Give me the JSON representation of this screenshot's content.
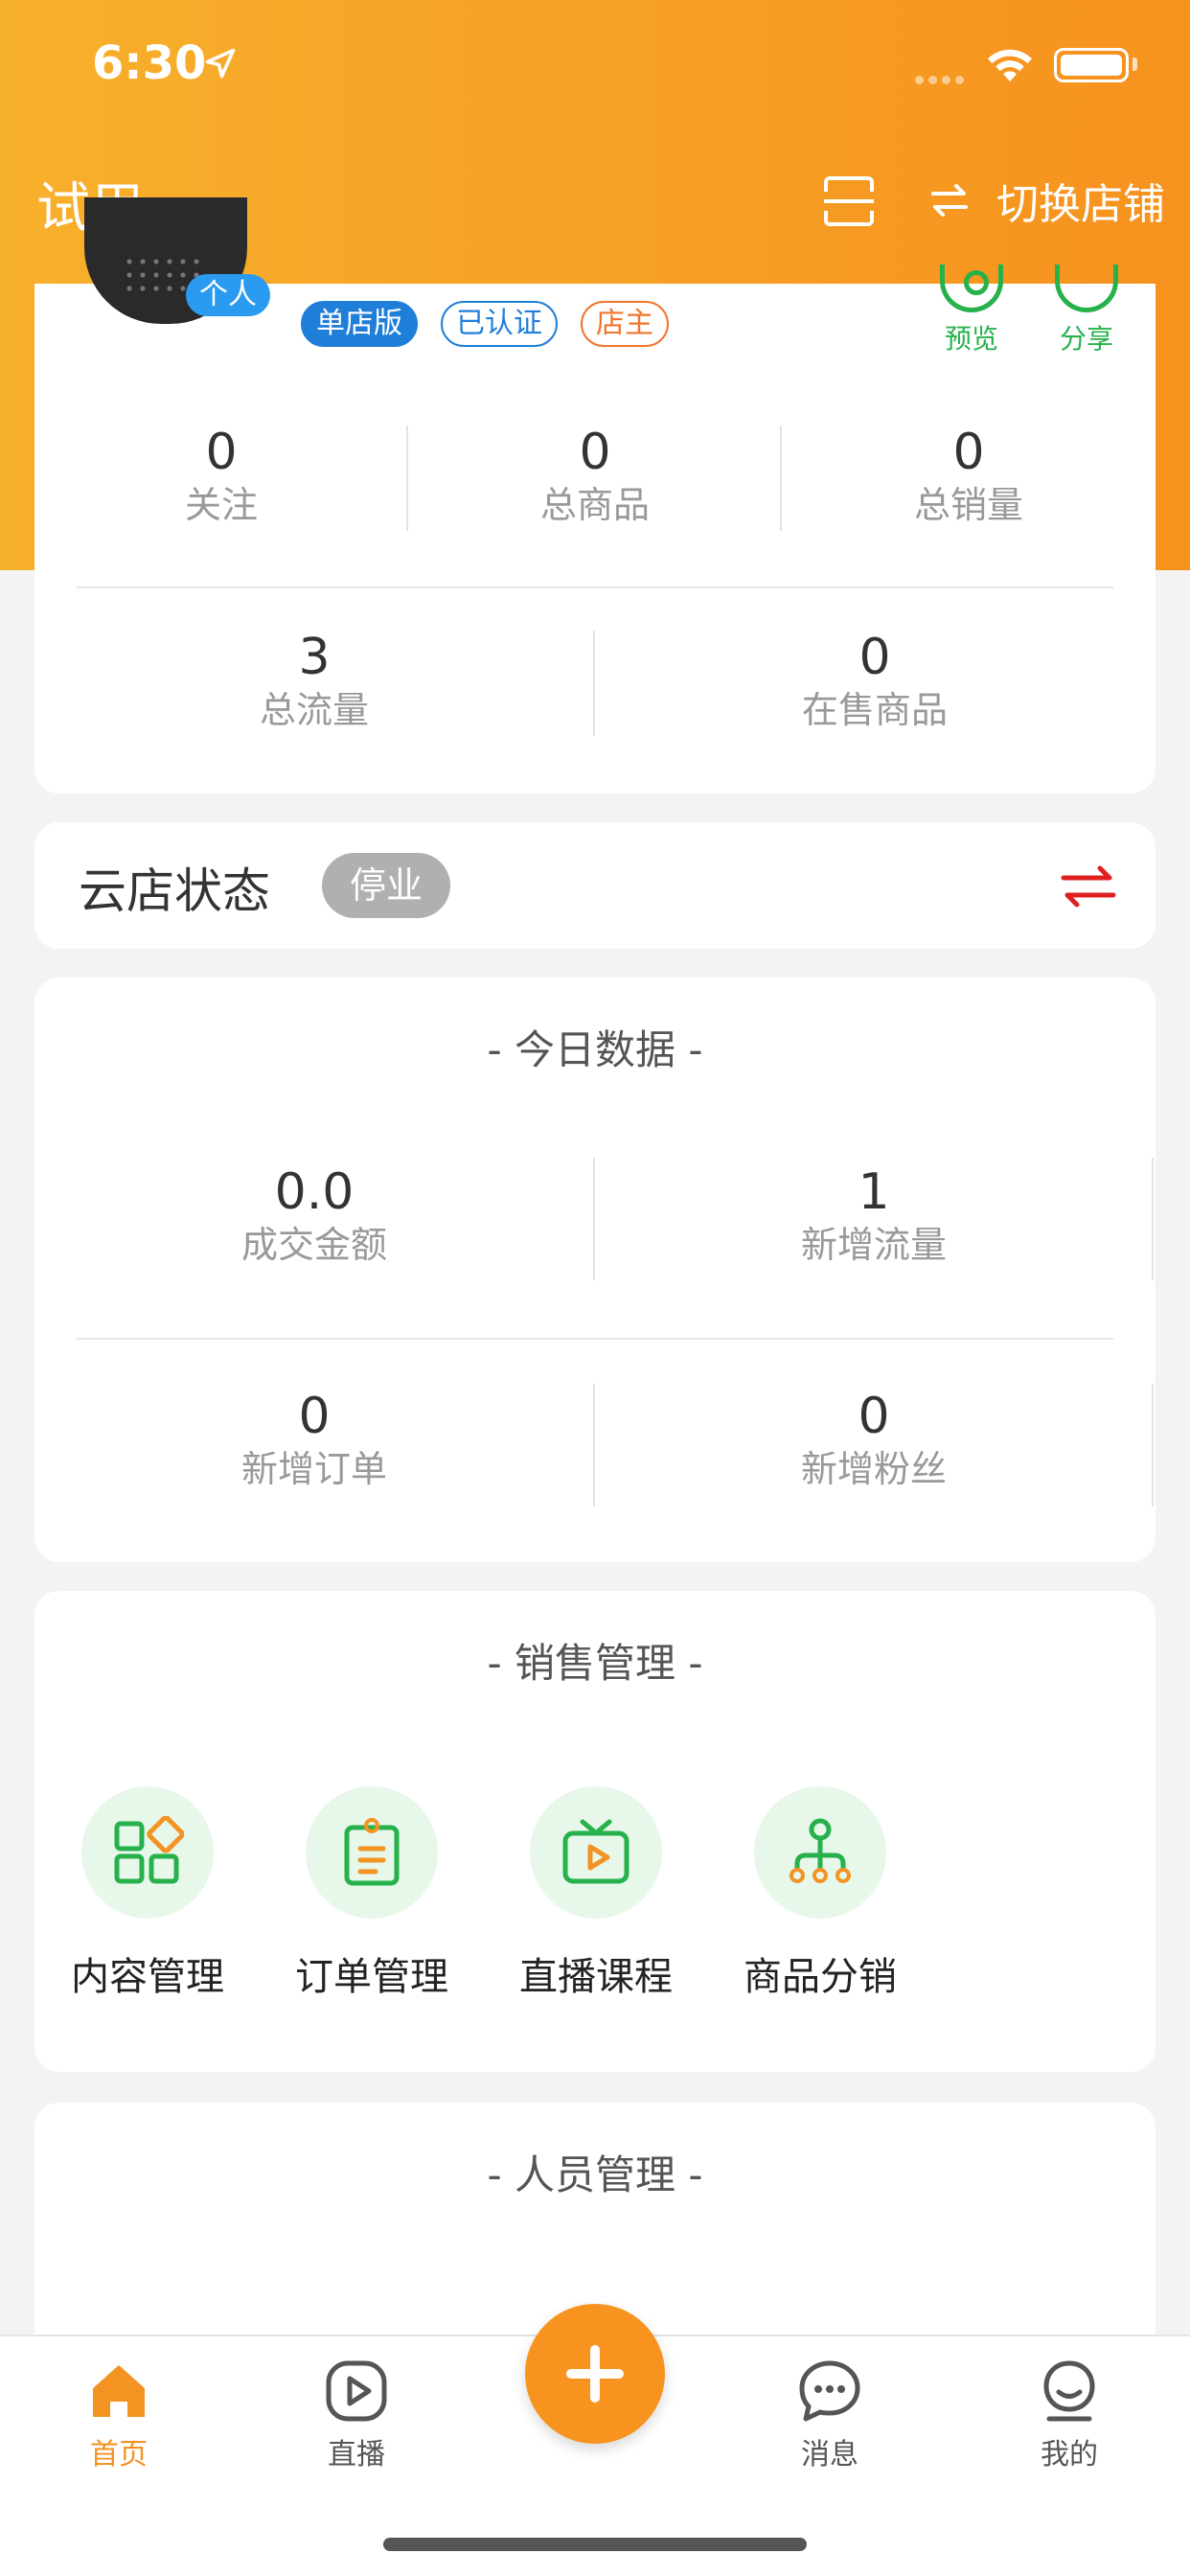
{
  "status_bar": {
    "time": "6:30"
  },
  "nav": {
    "title": "试用",
    "switch_store": "切换店铺"
  },
  "profile": {
    "person_tag": "个人",
    "tags": [
      "单店版",
      "已认证",
      "店主"
    ],
    "actions": {
      "preview": "预览",
      "share": "分享"
    },
    "stats_row1": [
      {
        "value": "0",
        "label": "关注"
      },
      {
        "value": "0",
        "label": "总商品"
      },
      {
        "value": "0",
        "label": "总销量"
      }
    ],
    "stats_row2": [
      {
        "value": "3",
        "label": "总流量"
      },
      {
        "value": "0",
        "label": "在售商品"
      }
    ]
  },
  "cloud_store": {
    "title": "云店状态",
    "status": "停业"
  },
  "today": {
    "title": "- 今日数据 -",
    "stats": [
      {
        "value": "0.0",
        "label": "成交金额"
      },
      {
        "value": "1",
        "label": "新增流量"
      },
      {
        "value": "0",
        "label": "新增订单"
      },
      {
        "value": "0",
        "label": "新增粉丝"
      }
    ]
  },
  "sales": {
    "title": "- 销售管理 -",
    "tools": [
      {
        "label": "内容管理",
        "icon": "grid-icon"
      },
      {
        "label": "订单管理",
        "icon": "clipboard-icon"
      },
      {
        "label": "直播课程",
        "icon": "tv-play-icon"
      },
      {
        "label": "商品分销",
        "icon": "distribution-icon"
      }
    ]
  },
  "people": {
    "title": "- 人员管理 -"
  },
  "tab_bar": {
    "items": [
      {
        "label": "首页",
        "icon": "home-icon"
      },
      {
        "label": "直播",
        "icon": "play-icon"
      },
      {
        "label": "消息",
        "icon": "message-icon"
      },
      {
        "label": "我的",
        "icon": "profile-icon"
      }
    ],
    "colors": {
      "active": "#f39322",
      "green": "#27b14b",
      "orange": "#f7931e"
    }
  }
}
